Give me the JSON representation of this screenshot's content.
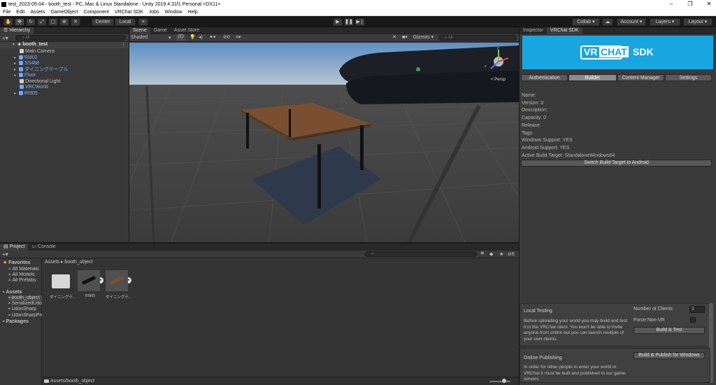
{
  "window": {
    "title": "test_2023-05-04 - booth_test - PC, Mac & Linux Standalone - Unity 2019.4.31f1 Personal <DX11>"
  },
  "menu": [
    "File",
    "Edit",
    "Assets",
    "GameObject",
    "Component",
    "VRChat SDK",
    "Jobs",
    "Window",
    "Help"
  ],
  "toolbar": {
    "pivot": "Center",
    "space": "Local",
    "collab": "Collab",
    "account": "Account",
    "layers": "Layers",
    "layout": "Layout"
  },
  "hierarchy": {
    "tab": "Hierarchy",
    "search_placeholder": "All",
    "scene": "booth_test",
    "items": [
      {
        "label": "Main Camera",
        "color": "white",
        "arrow": ""
      },
      {
        "label": "RI802",
        "color": "blue",
        "arrow": "▸"
      },
      {
        "label": "SS488",
        "color": "blue",
        "arrow": "▸"
      },
      {
        "label": "ダイニングテーブル",
        "color": "blue",
        "arrow": "▸"
      },
      {
        "label": "Floor",
        "color": "blue",
        "arrow": "▸"
      },
      {
        "label": "Directional Light",
        "color": "white",
        "arrow": ""
      },
      {
        "label": "VRCWorld",
        "color": "blue",
        "arrow": ""
      },
      {
        "label": "RI905",
        "color": "blue",
        "arrow": "▸"
      }
    ]
  },
  "scene": {
    "tabs": [
      "Scene",
      "Game",
      "Asset Store"
    ],
    "shading": "Shaded",
    "mode": "2D",
    "gizmos": "Gizmos",
    "search_placeholder": "All",
    "persp": "< Persp",
    "hidden": "0"
  },
  "inspector": {
    "tabs": [
      "Inspector",
      "VRChat SDK"
    ],
    "logo": {
      "left": "VR",
      "right": "CHAT",
      "sdk": "SDK"
    },
    "sdk_tabs": [
      "Authentication",
      "Builder",
      "Content Manager",
      "Settings"
    ],
    "fields": [
      "Name:",
      "Version: 0",
      "Description:",
      "Capacity: 0",
      "Release:",
      "Tags:",
      "Windows Support: YES",
      "Android Support: YES",
      "Active Build Target: StandaloneWindows64"
    ],
    "switch_button": "Switch Build Target to Android",
    "local_testing": {
      "title": "Local Testing",
      "text": "Before uploading your world you may build and test it in the VRChat client. You won't be able to invite anyone from online but you can launch multiple of your own clients.",
      "clients_label": "Number of Clients",
      "clients_value": "1",
      "force_label": "Force Non-VR",
      "button": "Build & Test"
    },
    "online": {
      "title": "Online Publishing",
      "text": "In order for other people to enter your world in VRChat it must be built and published to our game servers.",
      "button": "Build & Publish for Windows"
    }
  },
  "project": {
    "tabs": [
      "Project",
      "Console"
    ],
    "tree": [
      {
        "label": "Favorites",
        "bold": true,
        "indent": 0,
        "icon": "star"
      },
      {
        "label": "All Materials",
        "bold": false,
        "indent": 1,
        "icon": "search"
      },
      {
        "label": "All Models",
        "bold": false,
        "indent": 1,
        "icon": "search"
      },
      {
        "label": "All Prefabs",
        "bold": false,
        "indent": 1,
        "icon": "search"
      },
      {
        "label": "Assets",
        "bold": true,
        "indent": 0,
        "icon": "folder"
      },
      {
        "label": "booth_object",
        "bold": false,
        "indent": 1,
        "icon": "folder"
      },
      {
        "label": "SerializedUdonPrograms",
        "bold": false,
        "indent": 1,
        "icon": "folder"
      },
      {
        "label": "UdonSharp",
        "bold": false,
        "indent": 1,
        "icon": "folder"
      },
      {
        "label": "UdonSharpProgramAssets",
        "bold": false,
        "indent": 1,
        "icon": "folder"
      },
      {
        "label": "Packages",
        "bold": true,
        "indent": 0,
        "icon": "folder"
      }
    ],
    "breadcrumb": [
      "Assets",
      "booth_object"
    ],
    "assets": [
      {
        "label": "ダイニングテ...",
        "type": "folder"
      },
      {
        "label": "RI905",
        "type": "model"
      },
      {
        "label": "ダイニングテ...",
        "type": "model"
      }
    ],
    "footer_path": "Assets/booth_object",
    "hidden_count": "8"
  }
}
